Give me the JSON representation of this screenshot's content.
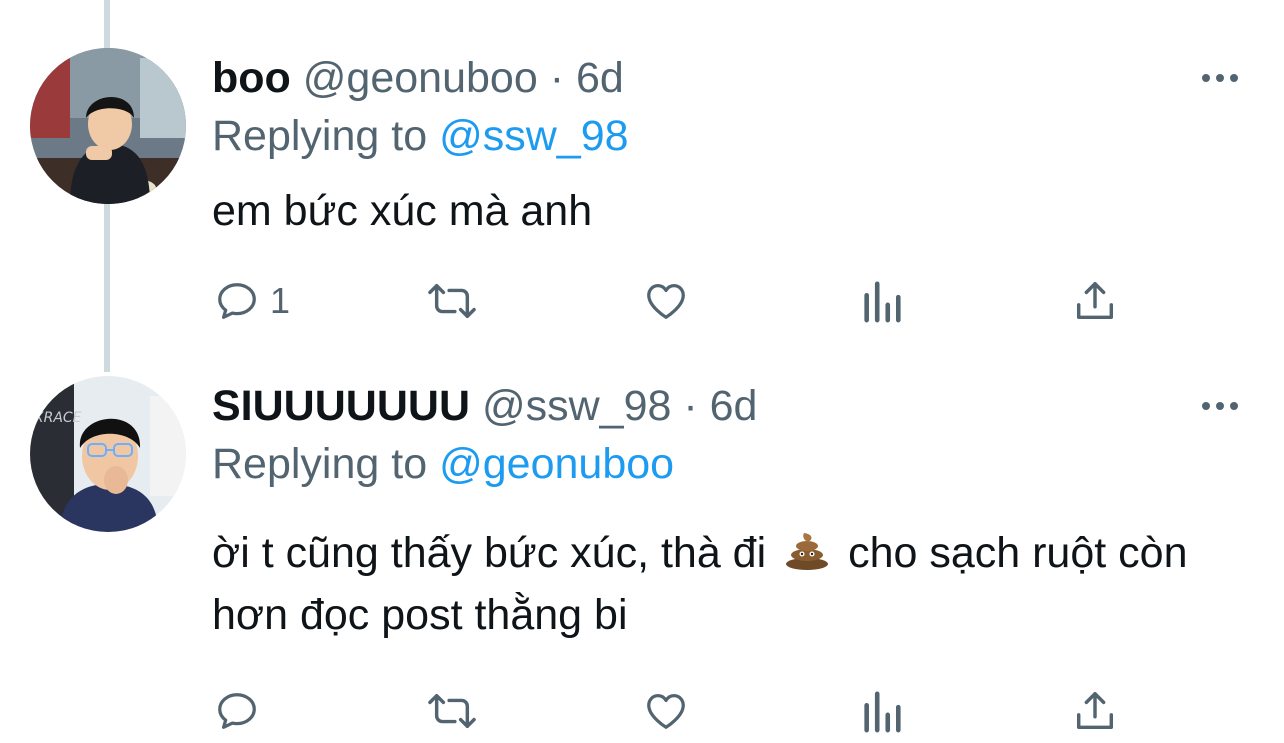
{
  "colors": {
    "text_primary": "#0f1419",
    "text_secondary": "#536471",
    "accent": "#1d9bf0",
    "thread_line": "#cfd9de"
  },
  "tweets": [
    {
      "display_name": "boo",
      "handle": "@geonuboo",
      "separator": "·",
      "time": "6d",
      "replying_prefix": "Replying to",
      "replying_to": "@ssw_98",
      "text_parts": [
        "em bức xúc mà anh"
      ],
      "reply_count": "1",
      "avatar_icon": "avatar-photo",
      "more_icon": "more-dots-icon"
    },
    {
      "display_name": "SIUUUUUUU",
      "handle": "@ssw_98",
      "separator": "·",
      "time": "6d",
      "replying_prefix": "Replying to",
      "replying_to": "@geonuboo",
      "text_parts": [
        "ời t cũng thấy bức xúc, thà đi",
        "cho sạch ruột còn hơn đọc post thằng bi"
      ],
      "inline_emoji": "pile-of-poo-emoji",
      "reply_count": "",
      "avatar_icon": "avatar-photo",
      "more_icon": "more-dots-icon"
    }
  ],
  "actions": [
    "reply-icon",
    "retweet-icon",
    "like-icon",
    "analytics-icon",
    "share-icon"
  ]
}
